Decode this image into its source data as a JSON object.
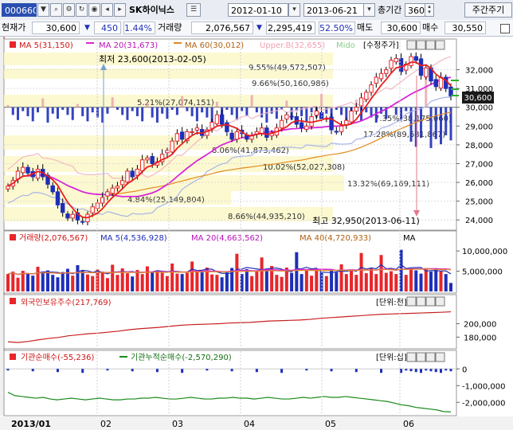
{
  "toolbar": {
    "code": "000660",
    "stock_name": "SK하이닉스",
    "start_date": "2012-01-10",
    "end_date": "2013-06-21",
    "period_label": "총기간",
    "period_value": "360",
    "weekly_button": "주간주기",
    "icons": [
      "dropdown-icon",
      "search-icon",
      "gear-icon",
      "refresh-icon",
      "eye-icon",
      "prev-icon",
      "next-icon",
      "list-icon"
    ]
  },
  "info": {
    "price_label": "현재가",
    "price": "30,600",
    "change_arrow": "▼",
    "change": "450",
    "change_pct": "1.44%",
    "volume_label": "거래량",
    "volume": "2,076,567",
    "prev_arrow": "▼",
    "prev_volume": "2,295,419",
    "ratio": "52.50%",
    "sell_label": "매도",
    "sell_price": "30,600",
    "buy_label": "매수",
    "buy_price": "30,550"
  },
  "legend_price": {
    "ma5": "MA 5(31,150)",
    "ma20": "MA 20(31,673)",
    "ma60": "MA 60(30,012)",
    "upper": "Upper.B(32,655)",
    "mid": "Mido",
    "adjusted": "[수정주가]"
  },
  "legend_volume": {
    "volume": "거래량(2,076,567)",
    "ma5": "MA 5(4,536,928)",
    "ma20": "MA 20(4,663,562)",
    "ma40": "MA 40(4,720,933)",
    "ma": "MA"
  },
  "legend_foreign": {
    "label": "외국인보유주수(217,769)",
    "unit": "[단위:천]"
  },
  "legend_inst": {
    "net": "기관순매수(-55,236)",
    "cum": "기관누적순매수(-2,570,290)",
    "unit": "[단위:십]"
  },
  "annotations": {
    "low": "최저 23,600(2013-02-05)",
    "high": "최고 32,950(2013-06-11)",
    "fib": [
      "9.55%(49,572,507)",
      "9.66%(50,160,986)",
      "5.21%(27,074,151)",
      "8.06%(41,873,462)",
      "10.02%(52,027,308)",
      "13.32%(69,169,111)",
      "4.84%(25,149,804)",
      "8.66%(44,935,210)",
      "7.35%(38,175,060)",
      "17.28%(89,681,867)"
    ]
  },
  "axes": {
    "price_ticks": [
      "32,000",
      "31,000",
      "30,000",
      "29,000",
      "28,000",
      "27,000",
      "26,000",
      "25,000",
      "24,000"
    ],
    "current_price_tag": "30,600",
    "volume_ticks": [
      "10,000,000",
      "5,000,000"
    ],
    "foreign_ticks": [
      "200,000",
      "180,000"
    ],
    "inst_ticks": [
      "0",
      "-1,000,000",
      "-2,000,000"
    ],
    "x_labels": [
      "2013/01",
      "02",
      "03",
      "04",
      "05",
      "06"
    ]
  },
  "colors": {
    "up": "#e8262b",
    "down": "#1e2fb8",
    "ma5": "#e81f1f",
    "ma20": "#d926d9",
    "ma60": "#e08a20",
    "band": "#f2b9c2",
    "fib_box": "#fbf8c8"
  },
  "chart_data": [
    {
      "type": "candlestick",
      "title": "SK하이닉스",
      "ylim": [
        23500,
        33000
      ],
      "x_labels": [
        "2013/01",
        "02",
        "03",
        "04",
        "05",
        "06"
      ],
      "close": [
        25800,
        26100,
        26600,
        26800,
        26500,
        26300,
        26700,
        26300,
        25900,
        25500,
        24800,
        24400,
        24100,
        24300,
        24000,
        23900,
        24300,
        24700,
        24900,
        25200,
        25500,
        25700,
        25800,
        26100,
        26600,
        26300,
        26700,
        27200,
        27300,
        27000,
        27100,
        27500,
        27700,
        28200,
        28600,
        28300,
        28700,
        28700,
        28900,
        28500,
        28800,
        29200,
        29600,
        29100,
        28700,
        28300,
        28700,
        28600,
        28300,
        28500,
        28700,
        28900,
        28400,
        28600,
        28900,
        29300,
        29600,
        29500,
        29100,
        28900,
        29000,
        29500,
        29800,
        29400,
        29400,
        28800,
        28700,
        29000,
        29300,
        29800,
        30000,
        30500,
        30800,
        31200,
        31600,
        31800,
        32000,
        32500,
        32600,
        31900,
        32300,
        32700,
        32500,
        31700,
        32100,
        31400,
        31100,
        31600,
        31000,
        30600
      ],
      "ma_series": [
        {
          "name": "MA 5(31,150)"
        },
        {
          "name": "MA 20(31,673)"
        },
        {
          "name": "MA 60(30,012)"
        }
      ],
      "annotations": [
        "최저 23,600(2013-02-05)",
        "최고 32,950(2013-06-11)"
      ]
    },
    {
      "type": "bar",
      "title": "거래량(2,076,567)",
      "ylim": [
        0,
        12000000
      ],
      "values": [
        4300000,
        4900000,
        3400000,
        5100000,
        4400000,
        3900000,
        6100000,
        4600000,
        5200000,
        4100000,
        3500000,
        4800000,
        5600000,
        3900000,
        6500000,
        5300000,
        4200000,
        3800000,
        5400000,
        4900000,
        3300000,
        6600000,
        4100000,
        5700000,
        4500000,
        3700000,
        5300000,
        4300000,
        6200000,
        4800000,
        5100000,
        4600000,
        3800000,
        6900000,
        4400000,
        4300000,
        4600000,
        7400000,
        5200000,
        4700000,
        5900000,
        4200000,
        4100000,
        3500000,
        4700000,
        5800000,
        9300000,
        4300000,
        5500000,
        3800000,
        4900000,
        8400000,
        5200000,
        6300000,
        4100000,
        3600000,
        5900000,
        4600000,
        9700000,
        4300000,
        5300000,
        3900000,
        5600000,
        4800000,
        3800000,
        5300000,
        4700000,
        6700000,
        4300000,
        5200000,
        4100000,
        9500000,
        4500000,
        5700000,
        4300000,
        9000000,
        4600000,
        5000000,
        4300000,
        10300000,
        4100000,
        5600000,
        5200000,
        4400000,
        5700000,
        4900000,
        5400000,
        5000000,
        4300000,
        2100000
      ],
      "series": [
        {
          "name": "MA 5(4,536,928)"
        },
        {
          "name": "MA 20(4,663,562)"
        },
        {
          "name": "MA 40(4,720,933)"
        }
      ]
    },
    {
      "type": "line",
      "title": "외국인보유주수(217,769)",
      "ylim": [
        165000,
        222000
      ],
      "values": [
        173000,
        172000,
        173500,
        176000,
        178000,
        179500,
        182000,
        183500,
        185000,
        186000,
        187500,
        189000,
        191000,
        192500,
        193500,
        194500,
        196000,
        197500,
        198500,
        199000,
        199500,
        200000,
        201000,
        201500,
        202000,
        203000,
        204000,
        204500,
        205000,
        205500,
        206500,
        208000,
        209000,
        210000,
        211000,
        212000,
        213000,
        214000,
        214500,
        215000,
        215500,
        216000,
        216500,
        217000,
        217769
      ]
    },
    {
      "type": "line",
      "title": "기관누적순매수(-2,570,290)",
      "ylim": [
        -2700000,
        250000
      ],
      "values": [
        -1400000,
        -1600000,
        -1650000,
        -1700000,
        -1750000,
        -1700000,
        -1800000,
        -1850000,
        -1800000,
        -1750000,
        -1800000,
        -1850000,
        -1800000,
        -1750000,
        -1800000,
        -1850000,
        -1850000,
        -1800000,
        -1800000,
        -1750000,
        -1750000,
        -1700000,
        -1750000,
        -1800000,
        -1800000,
        -1750000,
        -1700000,
        -1750000,
        -1800000,
        -1800000,
        -1750000,
        -1750000,
        -1700000,
        -1750000,
        -1750000,
        -1800000,
        -1750000,
        -1700000,
        -1750000,
        -1800000,
        -1800000,
        -1750000,
        -1700000,
        -1750000,
        -1700000,
        -1650000,
        -1700000,
        -1700000,
        -1650000,
        -1700000,
        -1750000,
        -1800000,
        -1850000,
        -1900000,
        -1950000,
        -2050000,
        -2150000,
        -2200000,
        -2300000,
        -2350000,
        -2400000,
        -2450000,
        -2550000,
        -2570290
      ],
      "series": [
        {
          "name": "기관순매수(-55,236)"
        },
        {
          "name": "기관누적순매수(-2,570,290)"
        }
      ]
    }
  ]
}
